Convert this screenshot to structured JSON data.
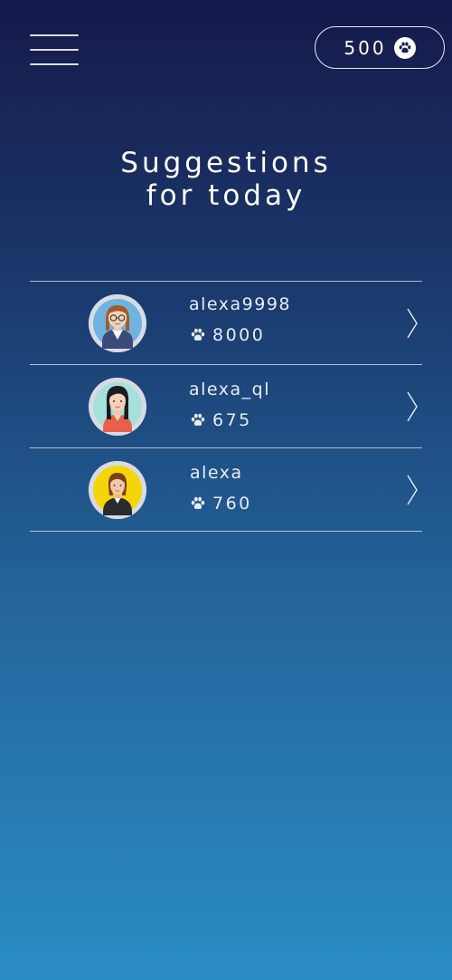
{
  "header": {
    "menu_icon": "hamburger-menu-icon",
    "coin_count": "500",
    "coin_icon": "paw-icon"
  },
  "title": {
    "line1": "Suggestions",
    "line2": "for today"
  },
  "suggestions": [
    {
      "username": "alexa9998",
      "score": "8000",
      "avatar": "woman-glasses-avatar"
    },
    {
      "username": "alexa_ql",
      "score": "675",
      "avatar": "woman-black-hair-avatar"
    },
    {
      "username": "alexa",
      "score": "760",
      "avatar": "woman-yellow-bg-avatar"
    }
  ],
  "colors": {
    "bg_top": "#16194a",
    "bg_bottom": "#2a8ec4",
    "text": "#ffffff"
  }
}
